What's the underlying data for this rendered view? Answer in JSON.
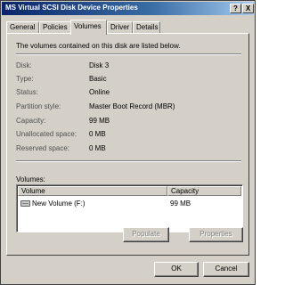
{
  "window": {
    "title": "MS Virtual SCSI Disk Device Properties",
    "help": "?",
    "close": "X"
  },
  "tabs": [
    "General",
    "Policies",
    "Volumes",
    "Driver",
    "Details"
  ],
  "active_tab": "Volumes",
  "panel": {
    "intro": "The volumes contained on this disk are listed below.",
    "fields": [
      {
        "label": "Disk:",
        "value": "Disk 3"
      },
      {
        "label": "Type:",
        "value": "Basic"
      },
      {
        "label": "Status:",
        "value": "Online"
      },
      {
        "label": "Partition style:",
        "value": "Master Boot Record (MBR)"
      },
      {
        "label": "Capacity:",
        "value": "99 MB"
      },
      {
        "label": "Unallocated space:",
        "value": "0 MB"
      },
      {
        "label": "Reserved space:",
        "value": "0 MB"
      }
    ],
    "volumes_label": "Volumes:",
    "columns": [
      "Volume",
      "Capacity"
    ],
    "rows": [
      {
        "volume": "New Volume (F:)",
        "capacity": "99 MB",
        "icon": "drive-icon"
      }
    ],
    "populate_button": "Populate",
    "properties_button": "Properties"
  },
  "footer": {
    "ok": "OK",
    "cancel": "Cancel"
  }
}
